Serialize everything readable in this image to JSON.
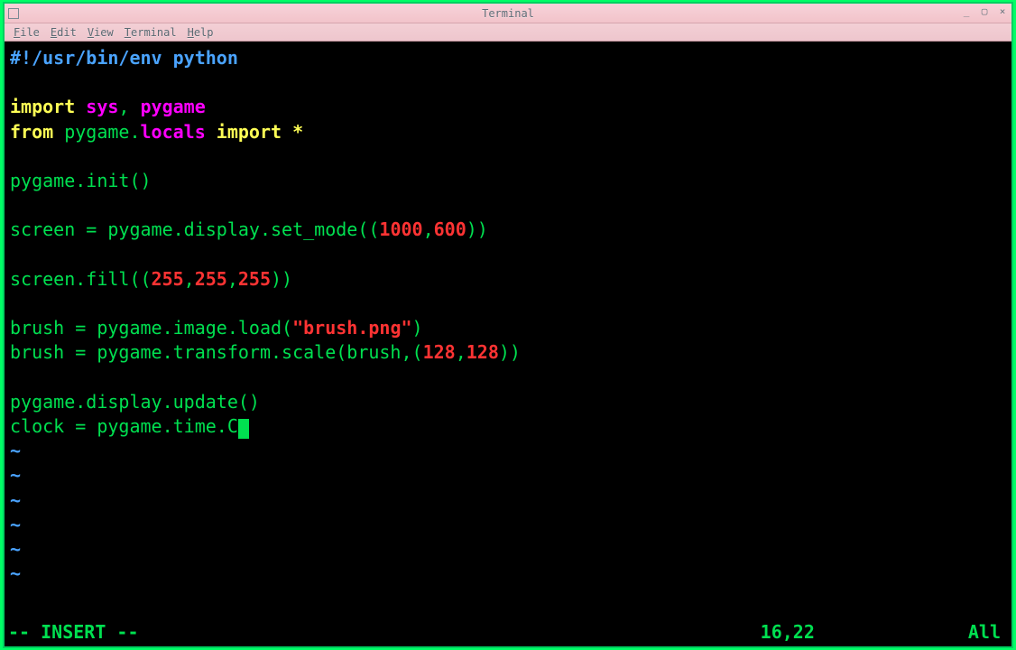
{
  "window": {
    "title": "Terminal",
    "menus": [
      "File",
      "Edit",
      "View",
      "Terminal",
      "Help"
    ]
  },
  "code": {
    "shebang": "#!/usr/bin/env python",
    "l2_import": "import",
    "l2_sys": "sys",
    "l2_comma": ", ",
    "l2_pygame": "pygame",
    "l3_from": "from",
    "l3_pkg": " pygame.",
    "l3_locals": "locals",
    "l3_import": " import",
    "l3_star": " *",
    "l4": "pygame.init()",
    "l5a": "screen = pygame.display.set_mode((",
    "l5n1": "1000",
    "l5c": ",",
    "l5n2": "600",
    "l5b": "))",
    "l6a": "screen.fill((",
    "l6n1": "255",
    "l6n2": "255",
    "l6n3": "255",
    "l6b": "))",
    "l7a": "brush = pygame.image.load(",
    "l7s": "\"brush.png\"",
    "l7b": ")",
    "l8a": "brush = pygame.transform.scale(brush,(",
    "l8n1": "128",
    "l8n2": "128",
    "l8b": "))",
    "l9": "pygame.display.update()",
    "l10": "clock = pygame.time.C",
    "tilde": "~"
  },
  "status": {
    "mode": "-- INSERT --",
    "position": "16,22",
    "percent": "All"
  }
}
